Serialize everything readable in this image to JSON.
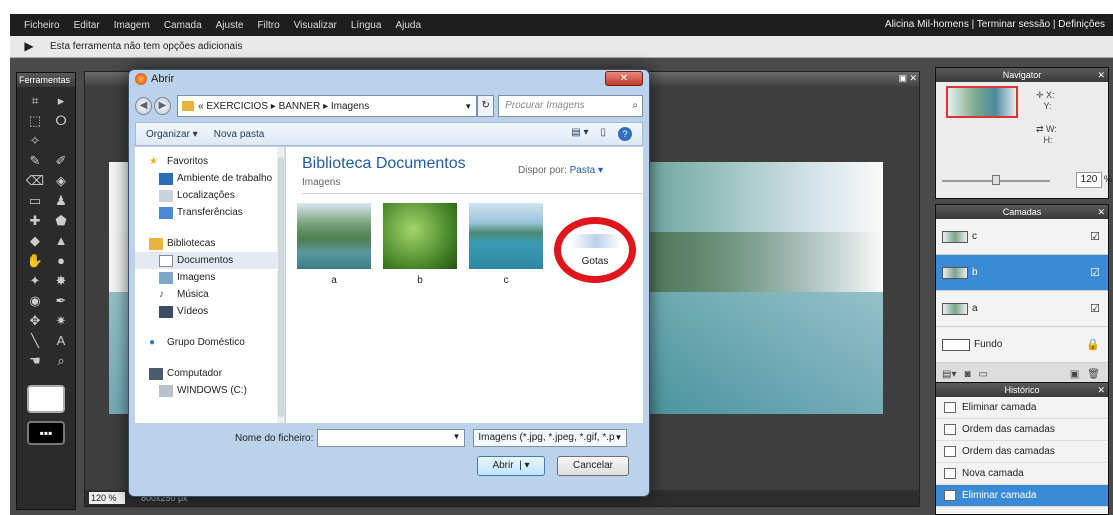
{
  "menubar": {
    "items": [
      "Ficheiro",
      "Editar",
      "Imagem",
      "Camada",
      "Ajuste",
      "Filtro",
      "Visualizar",
      "Língua",
      "Ajuda"
    ],
    "user_links": "Alicina Mil-homens | Terminar sessão | Definições"
  },
  "optionsbar": {
    "text": "Esta ferramenta não tem opções adicionais"
  },
  "tools_panel": {
    "title": "Ferramentas"
  },
  "document": {
    "zoom": "120 %",
    "size": "800x250 px"
  },
  "navigator": {
    "title": "Navigator",
    "x_label": "X:",
    "y_label": "Y:",
    "w_label": "W:",
    "h_label": "H:",
    "zoom_value": "120",
    "zoom_unit": "%"
  },
  "layers": {
    "title": "Camadas",
    "items": [
      {
        "name": "c",
        "selected": false
      },
      {
        "name": "b",
        "selected": true
      },
      {
        "name": "a",
        "selected": false
      },
      {
        "name": "Fundo",
        "selected": false
      }
    ]
  },
  "history": {
    "title": "Histórico",
    "items": [
      "Eliminar camada",
      "Ordem das camadas",
      "Ordem das camadas",
      "Nova camada",
      "Eliminar camada"
    ]
  },
  "dialog": {
    "title": "Abrir",
    "path": [
      "«",
      "EXERCICIOS",
      "▸",
      "BANNER",
      "▸",
      "Imagens"
    ],
    "search_placeholder": "Procurar Imagens",
    "organize_label": "Organizar ▾",
    "new_folder_label": "Nova pasta",
    "nav": {
      "favorites_header": "Favoritos",
      "favorites": [
        "Ambiente de trabalho",
        "Localizações",
        "Transferências"
      ],
      "libraries_header": "Bibliotecas",
      "libraries": [
        "Documentos",
        "Imagens",
        "Música",
        "Vídeos"
      ],
      "homegroup": "Grupo Doméstico",
      "computer_header": "Computador",
      "computer": [
        "WINDOWS (C:)"
      ]
    },
    "library_title": "Biblioteca Documentos",
    "library_subtitle": "Imagens",
    "arrange_label": "Dispor por:",
    "arrange_value": "Pasta ▾",
    "files": [
      "a",
      "b",
      "c"
    ],
    "folder": "Gotas",
    "filename_label": "Nome do ficheiro:",
    "filename_value": "",
    "file_types": "Imagens (*.jpg, *.jpeg, *.gif, *.p",
    "open_label": "Abrir",
    "cancel_label": "Cancelar"
  },
  "colors": {
    "accent": "#3a8ad6",
    "highlight_ring": "#e0161c"
  }
}
